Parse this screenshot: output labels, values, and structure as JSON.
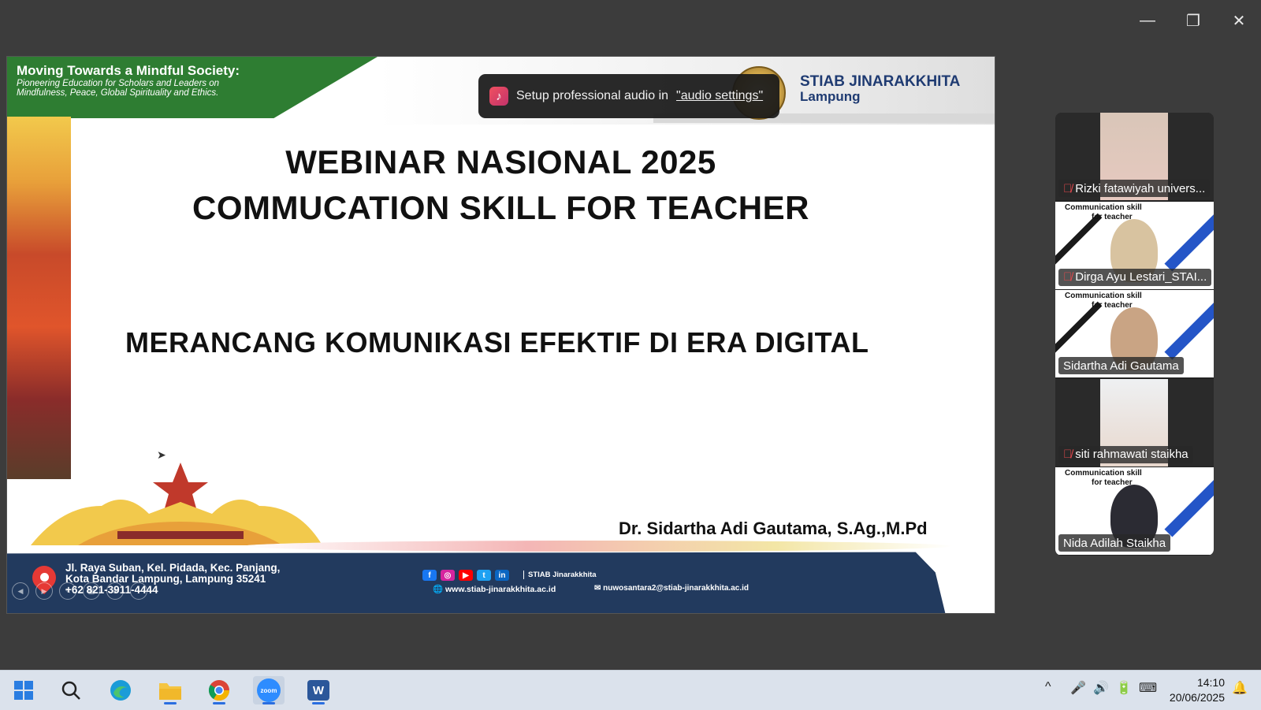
{
  "window": {
    "minimize_icon": "—",
    "restore_icon": "❐",
    "close_icon": "✕"
  },
  "slide": {
    "banner_title": "Moving Towards a Mindful Society:",
    "banner_sub_1": "Pioneering Education for Scholars and Leaders on",
    "banner_sub_2": "Mindfulness, Peace, Global Spirituality and Ethics.",
    "logo_name": "STIAB JINARAKKHITA",
    "logo_city": "Lampung",
    "title_1": "WEBINAR NASIONAL 2025",
    "title_2": "COMMUCATION SKILL FOR TEACHER",
    "subtitle": "MERANCANG KOMUNIKASI EFEKTIF DI ERA DIGITAL",
    "presenter": "Dr. Sidartha Adi Gautama, S.Ag.,M.Pd",
    "address_1": "Jl. Raya Suban, Kel. Pidada, Kec. Panjang,",
    "address_2": "Kota Bandar Lampung, Lampung 35241",
    "phone": "+62 821-3911-4444",
    "social_handle": "STIAB Jinarakkhita",
    "website": "www.stiab-jinarakkhita.ac.id",
    "email": "nuwosantara2@stiab-jinarakkhita.ac.id",
    "social_icons": [
      "f",
      "◎",
      "▶",
      "t",
      "in"
    ]
  },
  "toast": {
    "icon": "♪",
    "text": "Setup professional audio in",
    "link": "\"audio settings\""
  },
  "participants": [
    {
      "name": "Rizki fatawiyah univers...",
      "muted": true,
      "active": false
    },
    {
      "name": "Dirga Ayu Lestari_STAI...",
      "muted": true,
      "active": false
    },
    {
      "name": "Sidartha Adi Gautama",
      "muted": false,
      "active": true
    },
    {
      "name": "siti rahmawati staikha",
      "muted": true,
      "active": false
    },
    {
      "name": "Nida Adilah Staikha",
      "muted": false,
      "active": false
    }
  ],
  "tile_slide_text": {
    "line1": "Communication skill",
    "line2": "for teacher"
  },
  "taskbar": {
    "apps": [
      "start",
      "search",
      "edge",
      "file-explorer",
      "chrome",
      "zoom",
      "word"
    ],
    "zoom_label": "zoom",
    "word_label": "W",
    "time": "14:10",
    "date": "20/06/2025"
  },
  "colors": {
    "banner_green": "#2e7d32",
    "footer_navy": "#223a5e",
    "active_speaker": "#3ad27a",
    "taskbar": "#dbe2ec"
  }
}
